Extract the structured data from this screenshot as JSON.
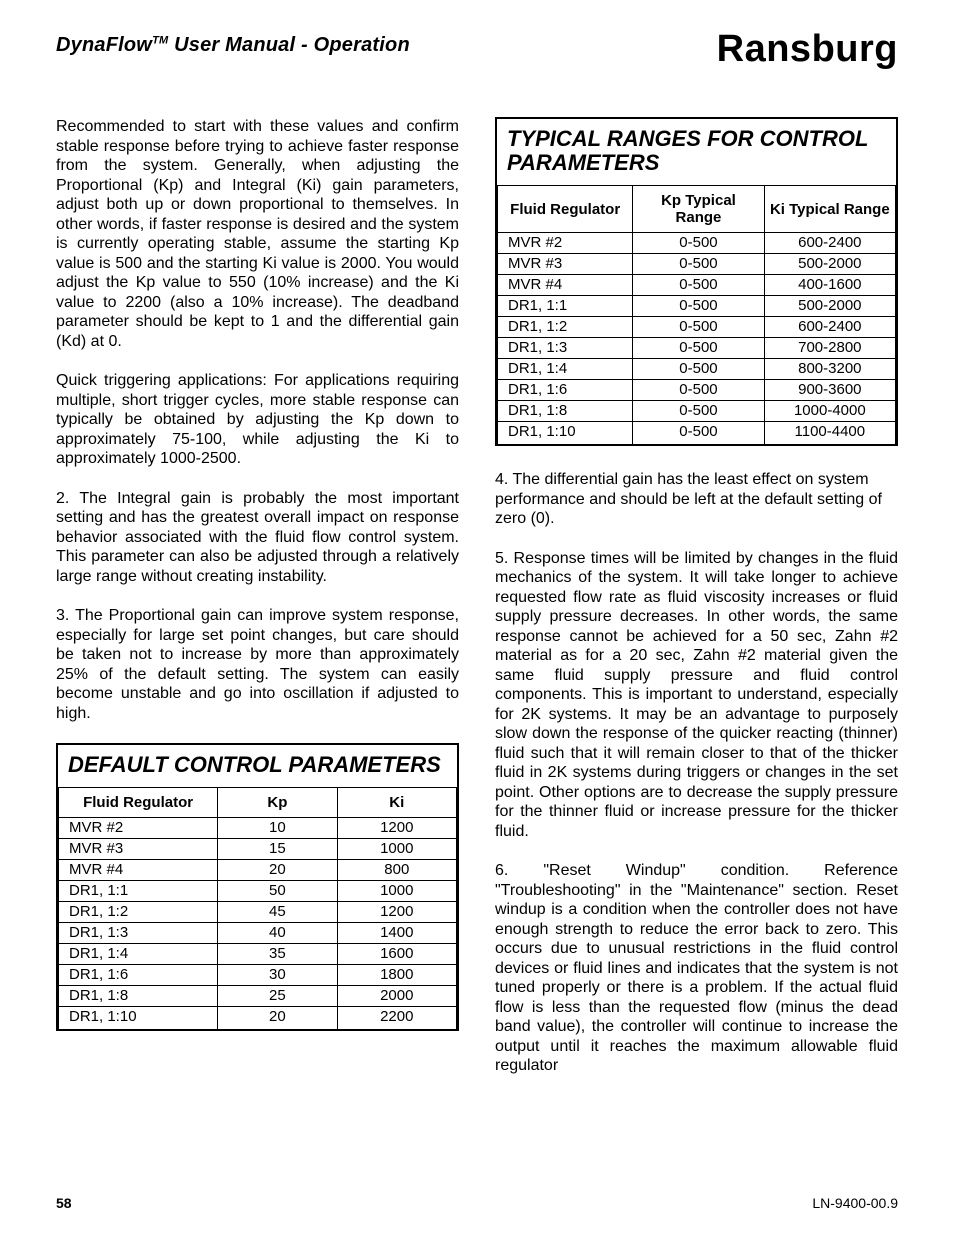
{
  "header": {
    "product": "DynaFlow",
    "tm": "TM",
    "subtitle": "User Manual - Operation",
    "brand": "Ransburg"
  },
  "left": {
    "p1": "Recommended to start with these values and confirm stable response before trying to achieve faster response from the system. Generally, when adjusting the Proportional (Kp) and Integral (Ki) gain parameters, adjust both up or down proportional to themselves. In other words, if faster response is desired and the system is currently operating stable, assume the starting Kp value is 500 and the starting Ki value is 2000. You would adjust the Kp value to 550 (10% increase) and the Ki value to 2200 (also a 10% increase). The deadband parameter should be kept to 1 and the differential gain (Kd) at 0.",
    "p2": "Quick triggering applications: For applications requiring multiple, short trigger cycles, more stable response can typically be obtained by adjusting the Kp down to approximately 75-100, while adjusting the Ki to approximately 1000-2500.",
    "p3": "2.  The Integral gain is probably the most important setting and has the greatest overall impact on response behavior associated with the fluid flow control system. This parameter can also be adjusted through a relatively large range without creating instability.",
    "p4": "3.  The Proportional gain can improve system response, especially for large set point changes, but care should be taken not to increase by more than approximately 25% of the default setting. The system can easily become unstable and go into oscillation if adjusted to high."
  },
  "table1": {
    "title": "DEFAULT CONTROL PARAMETERS",
    "headers": [
      "Fluid Regulator",
      "Kp",
      "Ki"
    ],
    "rows": [
      [
        "MVR #2",
        "10",
        "1200"
      ],
      [
        "MVR #3",
        "15",
        "1000"
      ],
      [
        "MVR #4",
        "20",
        "800"
      ],
      [
        "DR1, 1:1",
        "50",
        "1000"
      ],
      [
        "DR1, 1:2",
        "45",
        "1200"
      ],
      [
        "DR1, 1:3",
        "40",
        "1400"
      ],
      [
        "DR1, 1:4",
        "35",
        "1600"
      ],
      [
        "DR1, 1:6",
        "30",
        "1800"
      ],
      [
        "DR1, 1:8",
        "25",
        "2000"
      ],
      [
        "DR1, 1:10",
        "20",
        "2200"
      ]
    ]
  },
  "table2": {
    "title": "TYPICAL RANGES FOR CONTROL PARAMETERS",
    "headers": [
      "Fluid Regulator",
      "Kp Typical Range",
      "Ki Typical Range"
    ],
    "rows": [
      [
        "MVR #2",
        "0-500",
        "600-2400"
      ],
      [
        "MVR #3",
        "0-500",
        "500-2000"
      ],
      [
        "MVR #4",
        "0-500",
        "400-1600"
      ],
      [
        "DR1, 1:1",
        "0-500",
        "500-2000"
      ],
      [
        "DR1, 1:2",
        "0-500",
        "600-2400"
      ],
      [
        "DR1, 1:3",
        "0-500",
        "700-2800"
      ],
      [
        "DR1, 1:4",
        "0-500",
        "800-3200"
      ],
      [
        "DR1, 1:6",
        "0-500",
        "900-3600"
      ],
      [
        "DR1, 1:8",
        "0-500",
        "1000-4000"
      ],
      [
        "DR1, 1:10",
        "0-500",
        "1100-4400"
      ]
    ]
  },
  "right": {
    "p4": "4.  The differential gain has the least effect on system performance and should be left at the default setting of zero (0).",
    "p5": "5.  Response times will be limited by changes in the fluid mechanics of the system. It will take longer to achieve requested flow rate as fluid viscosity increases or fluid supply pressure decreases. In other words, the same response cannot be achieved for a 50 sec, Zahn #2 material as for a 20 sec, Zahn #2 material given the same fluid supply pressure and fluid control components. This is important to understand, especially for 2K systems. It may be an advantage to purposely slow down the response of the quicker reacting (thinner) fluid such that it will remain closer to that of the thicker fluid in 2K systems during triggers or changes in  the set point. Other options are to decrease the supply pressure for the thinner fluid or increase pressure for the thicker fluid.",
    "p6": "6. \"Reset Windup\" condition. Reference \"Troubleshooting\" in the \"Maintenance\" section.  Reset windup is a condition when the controller does not have enough strength to reduce the error back to zero. This occurs due to unusual restrictions in the fluid control devices or fluid lines and indicates that the system is not tuned properly or there is a problem. If the actual fluid flow is less than the requested flow  (minus the dead band value), the controller will continue to increase the output until it  reaches the maximum allowable fluid regulator"
  },
  "footer": {
    "page": "58",
    "doc": "LN-9400-00.9"
  }
}
